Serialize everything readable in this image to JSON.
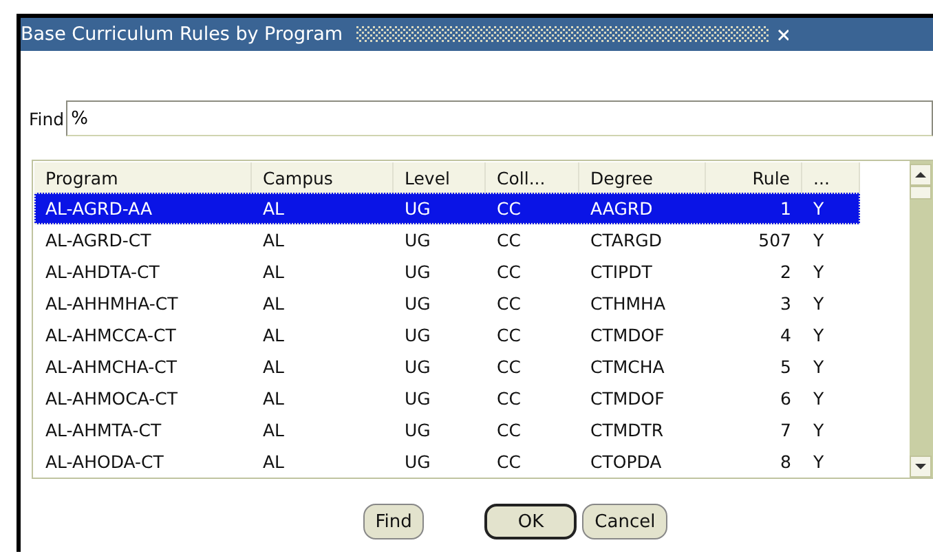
{
  "window": {
    "title": "Base Curriculum Rules by Program"
  },
  "find": {
    "label": "Find",
    "value": "%"
  },
  "table": {
    "columns": [
      {
        "label": "Program",
        "kind": "text"
      },
      {
        "label": "Campus",
        "kind": "text"
      },
      {
        "label": "Level",
        "kind": "text"
      },
      {
        "label": "Coll...",
        "kind": "text"
      },
      {
        "label": "Degree",
        "kind": "text"
      },
      {
        "label": "Rule",
        "kind": "number"
      },
      {
        "label": "...",
        "kind": "text"
      }
    ],
    "rows": [
      {
        "selected": true,
        "cells": [
          "AL-AGRD-AA",
          "AL",
          "UG",
          "CC",
          "AAGRD",
          "1",
          "Y"
        ]
      },
      {
        "selected": false,
        "cells": [
          "AL-AGRD-CT",
          "AL",
          "UG",
          "CC",
          "CTARGD",
          "507",
          "Y"
        ]
      },
      {
        "selected": false,
        "cells": [
          "AL-AHDTA-CT",
          "AL",
          "UG",
          "CC",
          "CTIPDT",
          "2",
          "Y"
        ]
      },
      {
        "selected": false,
        "cells": [
          "AL-AHHMHA-CT",
          "AL",
          "UG",
          "CC",
          "CTHMHA",
          "3",
          "Y"
        ]
      },
      {
        "selected": false,
        "cells": [
          "AL-AHMCCA-CT",
          "AL",
          "UG",
          "CC",
          "CTMDOF",
          "4",
          "Y"
        ]
      },
      {
        "selected": false,
        "cells": [
          "AL-AHMCHA-CT",
          "AL",
          "UG",
          "CC",
          "CTMCHA",
          "5",
          "Y"
        ]
      },
      {
        "selected": false,
        "cells": [
          "AL-AHMOCA-CT",
          "AL",
          "UG",
          "CC",
          "CTMDOF",
          "6",
          "Y"
        ]
      },
      {
        "selected": false,
        "cells": [
          "AL-AHMTA-CT",
          "AL",
          "UG",
          "CC",
          "CTMDTR",
          "7",
          "Y"
        ]
      },
      {
        "selected": false,
        "cells": [
          "AL-AHODA-CT",
          "AL",
          "UG",
          "CC",
          "CTOPDA",
          "8",
          "Y"
        ]
      }
    ]
  },
  "buttons": [
    {
      "label": "Find",
      "default": false
    },
    {
      "label": "OK",
      "default": true
    },
    {
      "label": "Cancel",
      "default": false
    }
  ]
}
